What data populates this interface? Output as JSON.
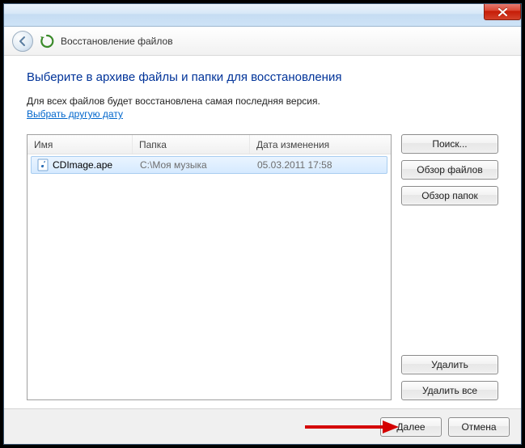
{
  "nav": {
    "title": "Восстановление файлов"
  },
  "heading": "Выберите в архиве файлы и папки для восстановления",
  "description": "Для всех файлов будет восстановлена самая последняя версия.",
  "link_text": "Выбрать другую дату",
  "columns": {
    "name": "Имя",
    "folder": "Папка",
    "date": "Дата изменения"
  },
  "rows": [
    {
      "name": "CDImage.ape",
      "folder": "C:\\Моя музыка",
      "date": "05.03.2011 17:58"
    }
  ],
  "side": {
    "search": "Поиск...",
    "browse_files": "Обзор файлов",
    "browse_folders": "Обзор папок",
    "delete": "Удалить",
    "delete_all": "Удалить все"
  },
  "footer": {
    "next": "Далее",
    "cancel": "Отмена"
  }
}
